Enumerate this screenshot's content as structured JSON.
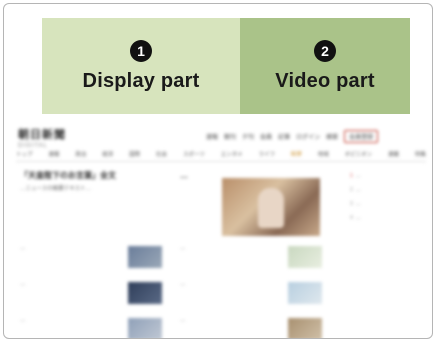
{
  "labels": {
    "display": {
      "number": "1",
      "text": "Display part",
      "color": "#d7e4bd"
    },
    "video": {
      "number": "2",
      "text": "Video part",
      "color": "#aac389"
    }
  },
  "site": {
    "logo_text": "朝日新聞",
    "logo_subtext": "DIGITAL",
    "top_nav": [
      "速報",
      "朝刊",
      "夕刊",
      "会員",
      "記事",
      "ログイン",
      "検索"
    ],
    "top_button": "会員登録",
    "nav_items": [
      "トップ",
      "速報",
      "政治",
      "経済",
      "国際",
      "社会",
      "スポーツ",
      "エンタメ",
      "ライフ",
      "科学",
      "地域",
      "オピニオン",
      "連載",
      "特集"
    ],
    "headline_title": "「天皇陛下のお言葉」全文",
    "headline_sub": "…ニュースの概要テキスト…",
    "headline_b": "…",
    "side_items": [
      {
        "num": "1",
        "text": "…"
      },
      {
        "num": "2",
        "text": "…"
      },
      {
        "num": "3",
        "text": "…"
      },
      {
        "num": "4",
        "text": "…"
      }
    ],
    "news": [
      {
        "text": "…"
      },
      {
        "text": "…"
      },
      {
        "text": "…"
      },
      {
        "text": "…"
      },
      {
        "text": "…"
      },
      {
        "text": "…"
      }
    ]
  },
  "colors": {
    "frame_border": "#b5b5b5",
    "accent_red": "#c0392b"
  }
}
